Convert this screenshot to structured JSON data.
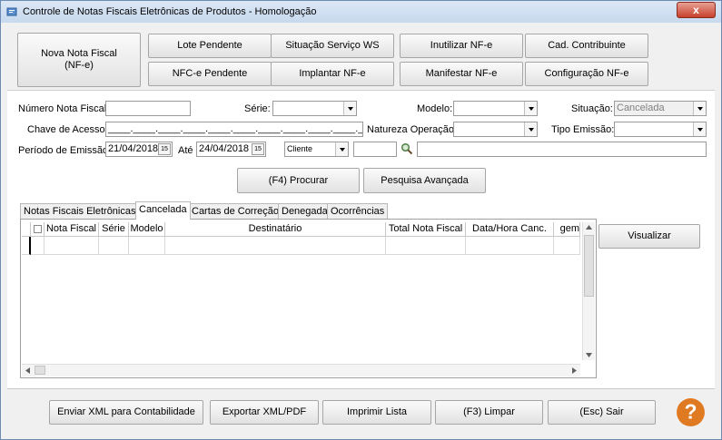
{
  "window": {
    "title": "Controle de Notas Fiscais Eletrônicas de Produtos - Homologação",
    "close_label": "x"
  },
  "toolbar": {
    "nova_nota": "Nova Nota Fiscal\n(NF-e)",
    "lote_pendente": "Lote Pendente",
    "situacao_servico": "Situação Serviço WS",
    "inutilizar": "Inutilizar NF-e",
    "cad_contribuinte": "Cad. Contribuinte",
    "nfce_pendente": "NFC-e Pendente",
    "implantar": "Implantar NF-e",
    "manifestar": "Manifestar NF-e",
    "configuracao": "Configuração NF-e"
  },
  "filters": {
    "numero_label": "Número Nota Fiscal:",
    "serie_label": "Série:",
    "modelo_label": "Modelo:",
    "situacao_label": "Situação:",
    "situacao_value": "Cancelada",
    "chave_label": "Chave de Acesso:",
    "chave_mask": "____.____.____.____.____.____.____.____.____.____.____",
    "natureza_label": "Natureza Operação:",
    "tipo_emissao_label": "Tipo Emissão:",
    "periodo_label": "Período de Emissão:",
    "data_inicio": "21/04/2018",
    "ate_label": "Até",
    "data_fim": "24/04/2018",
    "cliente_value": "Cliente",
    "cal_label": "15"
  },
  "search": {
    "procurar": "(F4) Procurar",
    "avancada": "Pesquisa Avançada"
  },
  "tabs": [
    "Notas Fiscais Eletrônicas",
    "Cancelada",
    "Cartas de Correção",
    "Denegada",
    "Ocorrências"
  ],
  "grid": {
    "columns": [
      "Nota Fiscal",
      "Série",
      "Modelo",
      "Destinatário",
      "Total Nota Fiscal",
      "Data/Hora Canc.",
      "gem"
    ]
  },
  "side": {
    "visualizar": "Visualizar"
  },
  "bottom": {
    "enviar_xml": "Enviar XML para Contabilidade",
    "exportar": "Exportar XML/PDF",
    "imprimir": "Imprimir Lista",
    "limpar": "(F3) Limpar",
    "sair": "(Esc) Sair"
  },
  "colors": {
    "help": "#e07a22"
  }
}
